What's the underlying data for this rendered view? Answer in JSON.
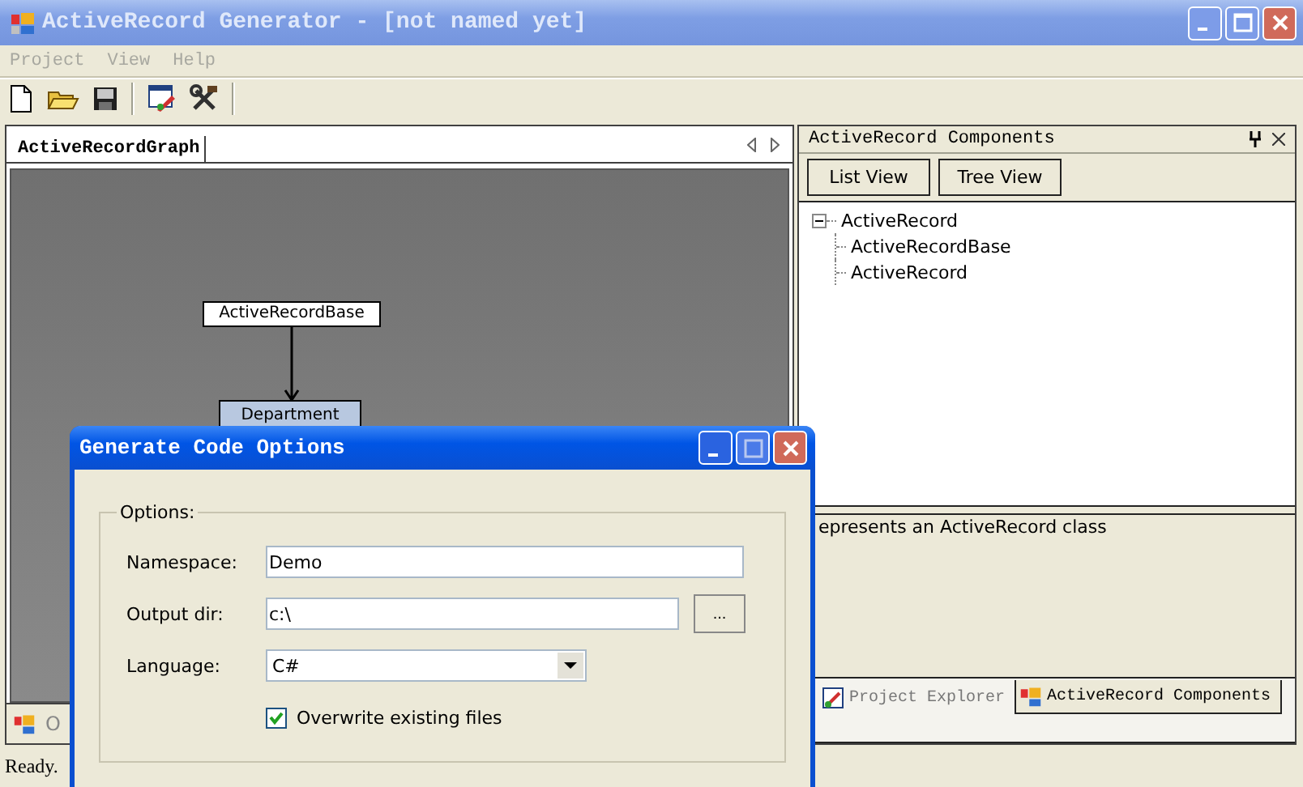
{
  "window": {
    "title": "ActiveRecord Generator - [not named yet]"
  },
  "menu": [
    {
      "label": "Project"
    },
    {
      "label": "View"
    },
    {
      "label": "Help"
    }
  ],
  "document_tabs": [
    {
      "label": "ActiveRecordGraph",
      "selected": true
    }
  ],
  "graph": {
    "nodes": [
      {
        "label": "ActiveRecordBase",
        "kind": "class"
      },
      {
        "label": "Department",
        "kind": "entity"
      }
    ]
  },
  "bottom_tabs": [
    {
      "label": "O"
    }
  ],
  "components_panel": {
    "title": "ActiveRecord Components",
    "buttons": [
      "List View",
      "Tree View"
    ],
    "tree": [
      {
        "label": "ActiveRecord",
        "expanded": true,
        "children": [
          {
            "label": "ActiveRecordBase"
          },
          {
            "label": "ActiveRecord"
          }
        ]
      }
    ],
    "description": "epresents an ActiveRecord class",
    "tabs": [
      {
        "label": "Project Explorer",
        "selected": false
      },
      {
        "label": "ActiveRecord Components",
        "selected": true
      }
    ]
  },
  "status_bar": "Ready.",
  "dialog": {
    "title": "Generate Code Options",
    "group": "Options:",
    "fields": [
      {
        "kind": "text",
        "label": "Namespace:",
        "value": "Demo"
      },
      {
        "kind": "browse",
        "label": "Output dir:",
        "value": "c:\\",
        "button": "..."
      },
      {
        "kind": "select",
        "label": "Language:",
        "value": "C#"
      }
    ],
    "checkbox": {
      "label": "Overwrite existing files",
      "checked": true
    }
  }
}
